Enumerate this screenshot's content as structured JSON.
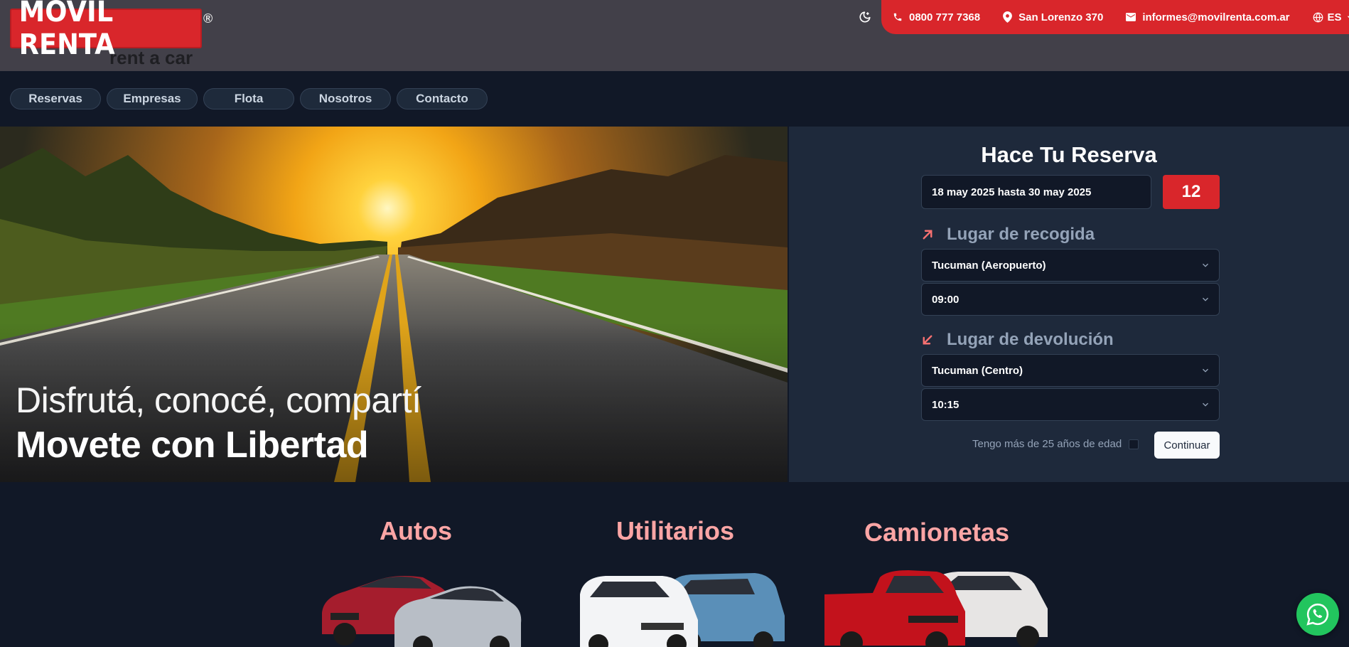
{
  "header": {
    "logo_text": "MOVIL RENTA",
    "logo_reg": "®",
    "logo_sub": "rent a car",
    "phone": "0800 777 7368",
    "address": "San Lorenzo 370",
    "email": "informes@movilrenta.com.ar",
    "language": "ES",
    "theme_icon": "moon-icon"
  },
  "nav": {
    "items": [
      {
        "label": "Reservas"
      },
      {
        "label": "Empresas"
      },
      {
        "label": "Flota"
      },
      {
        "label": "Nosotros"
      },
      {
        "label": "Contacto"
      }
    ]
  },
  "hero": {
    "line1": "Disfrutá, conocé, compartí",
    "line2": "Movete con Libertad"
  },
  "booking": {
    "title": "Hace Tu Reserva",
    "date_range": "18 may 2025 hasta 30 may 2025",
    "days": "12",
    "pickup": {
      "heading": "Lugar de recogida",
      "location": "Tucuman (Aeropuerto)",
      "time": "09:00"
    },
    "dropoff": {
      "heading": "Lugar de devolución",
      "location": "Tucuman (Centro)",
      "time": "10:15"
    },
    "age_label": "Tengo más de 25 años de edad",
    "continue_label": "Continuar"
  },
  "categories": [
    {
      "label": "Autos",
      "icon": "car-pair-image"
    },
    {
      "label": "Utilitarios",
      "icon": "van-pair-image"
    },
    {
      "label": "Camionetas",
      "icon": "pickup-pair-image"
    }
  ],
  "colors": {
    "brand_red": "#d9262b",
    "header_bg": "#424049",
    "page_bg": "#111827",
    "panel_bg": "#1e293b",
    "category_title": "#fca5a5",
    "whatsapp": "#22c55e"
  }
}
